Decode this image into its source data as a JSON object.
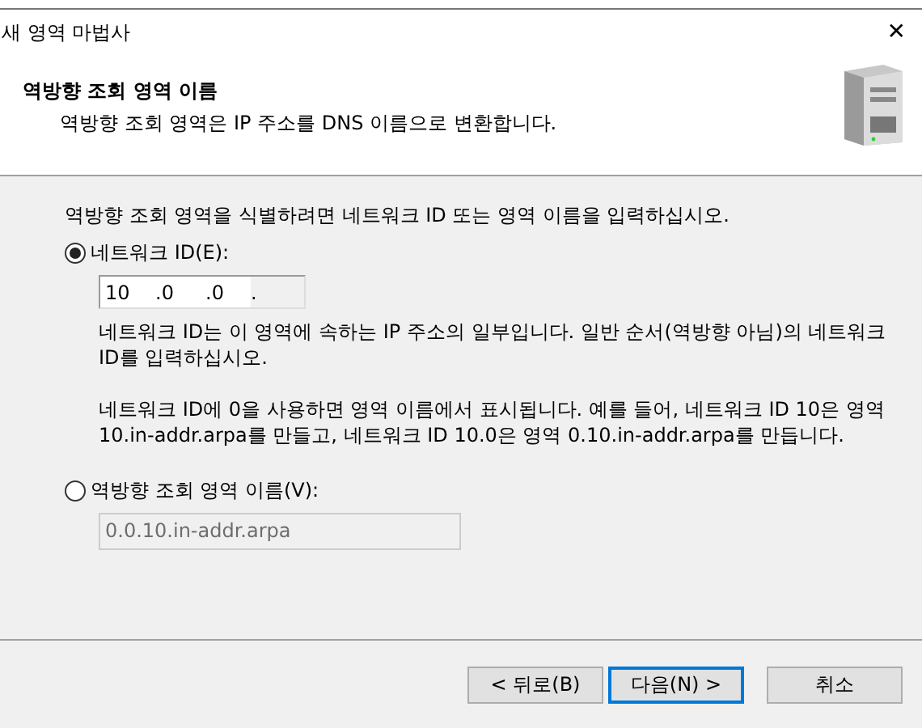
{
  "window": {
    "title": "새 영역 마법사",
    "close": "✕"
  },
  "header": {
    "title": "역방향 조회 영역 이름",
    "subtitle": "역방향 조회 영역은 IP 주소를 DNS 이름으로 변환합니다."
  },
  "intro": "역방향 조회 영역을 식별하려면 네트워크 ID 또는 영역 이름을 입력하십시오.",
  "options": [
    {
      "kind": "ip",
      "label": "네트워크 ID(E):",
      "selected": true,
      "octets": [
        "10",
        ".0",
        ".0",
        "."
      ],
      "notes": [
        "네트워크 ID는 이 영역에 속하는 IP 주소의 일부입니다. 일반 순서(역방향 아님)의 네트워크 ID를 입력하십시오.",
        "네트워크 ID에 0을 사용하면 영역 이름에서 표시됩니다. 예를 들어, 네트워크 ID 10은 영역 10.in-addr.arpa를 만들고, 네트워크 ID 10.0은 영역 0.10.in-addr.arpa를 만듭니다."
      ]
    },
    {
      "kind": "name",
      "label": "역방향 조회 영역 이름(V):",
      "selected": false,
      "value": "0.0.10.in-addr.arpa"
    }
  ],
  "buttons": [
    {
      "label": "< 뒤로(B)",
      "default": false
    },
    {
      "label": "다음(N) >",
      "default": true
    },
    {
      "label": "취소",
      "default": false
    }
  ]
}
